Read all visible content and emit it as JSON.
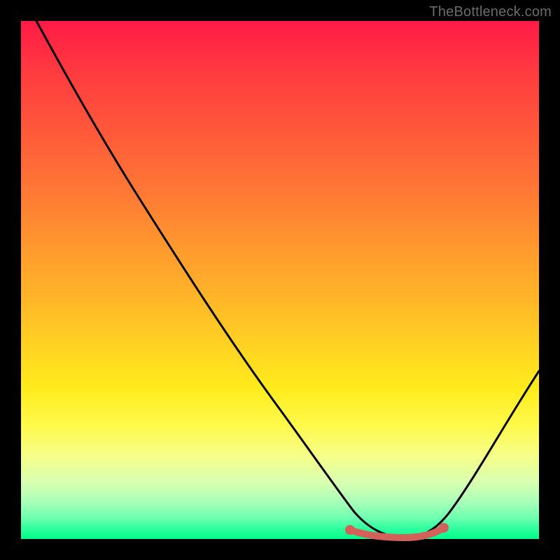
{
  "watermark": "TheBottleneck.com",
  "chart_data": {
    "type": "line",
    "title": "",
    "xlabel": "",
    "ylabel": "",
    "xlim": [
      0,
      100
    ],
    "ylim": [
      0,
      100
    ],
    "grid": false,
    "legend": false,
    "series": [
      {
        "name": "bottleneck-curve",
        "x": [
          3,
          10,
          20,
          30,
          40,
          50,
          58,
          63,
          67,
          72,
          76,
          80,
          85,
          90,
          95,
          100
        ],
        "y": [
          100,
          90,
          76,
          62,
          48,
          34,
          20,
          10,
          3,
          0,
          0,
          1,
          8,
          18,
          30,
          44
        ]
      }
    ],
    "annotations": [
      {
        "name": "optimal-range",
        "x_start": 63,
        "x_end": 80,
        "y": 0.5,
        "color": "#d4605a"
      }
    ],
    "background_gradient": {
      "top": "#ff1a47",
      "bottom": "#00ff88"
    }
  }
}
